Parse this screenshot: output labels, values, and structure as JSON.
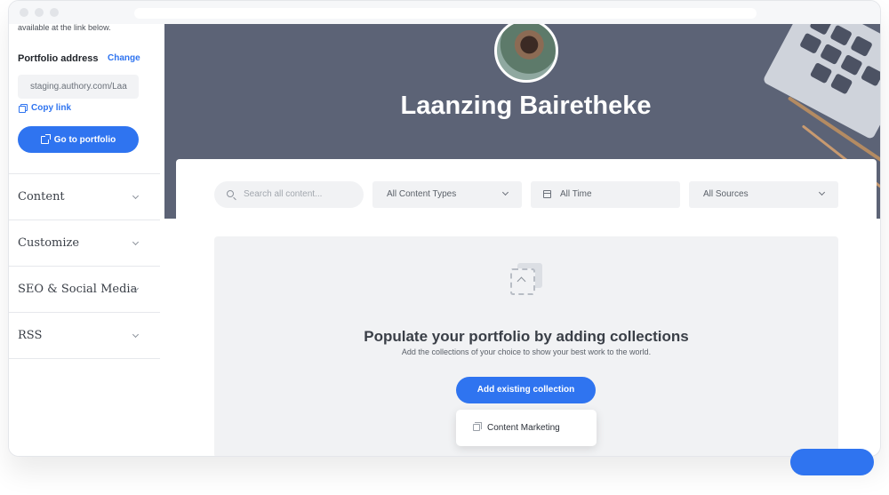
{
  "sidebar": {
    "note": "available at the link below.",
    "portfolio_address_label": "Portfolio address",
    "change_label": "Change",
    "portfolio_url": "staging.authory.com/Laa",
    "copy_link_label": "Copy link",
    "go_to_portfolio_label": "Go to portfolio",
    "items": [
      {
        "label": "Content"
      },
      {
        "label": "Customize"
      },
      {
        "label": "SEO & Social Media"
      },
      {
        "label": "RSS"
      }
    ]
  },
  "hero": {
    "name": "Laanzing Bairetheke"
  },
  "filters": {
    "search_placeholder": "Search all content...",
    "content_types": "All Content Types",
    "time": "All Time",
    "sources": "All Sources"
  },
  "empty_state": {
    "title": "Populate your portfolio by adding collections",
    "subtitle": "Add the collections of your choice to show your best work to the world.",
    "add_button_label": "Add existing collection",
    "dropdown_item": "Content Marketing"
  },
  "colors": {
    "accent": "#2f74f0",
    "hero_bg": "#5c6376"
  }
}
